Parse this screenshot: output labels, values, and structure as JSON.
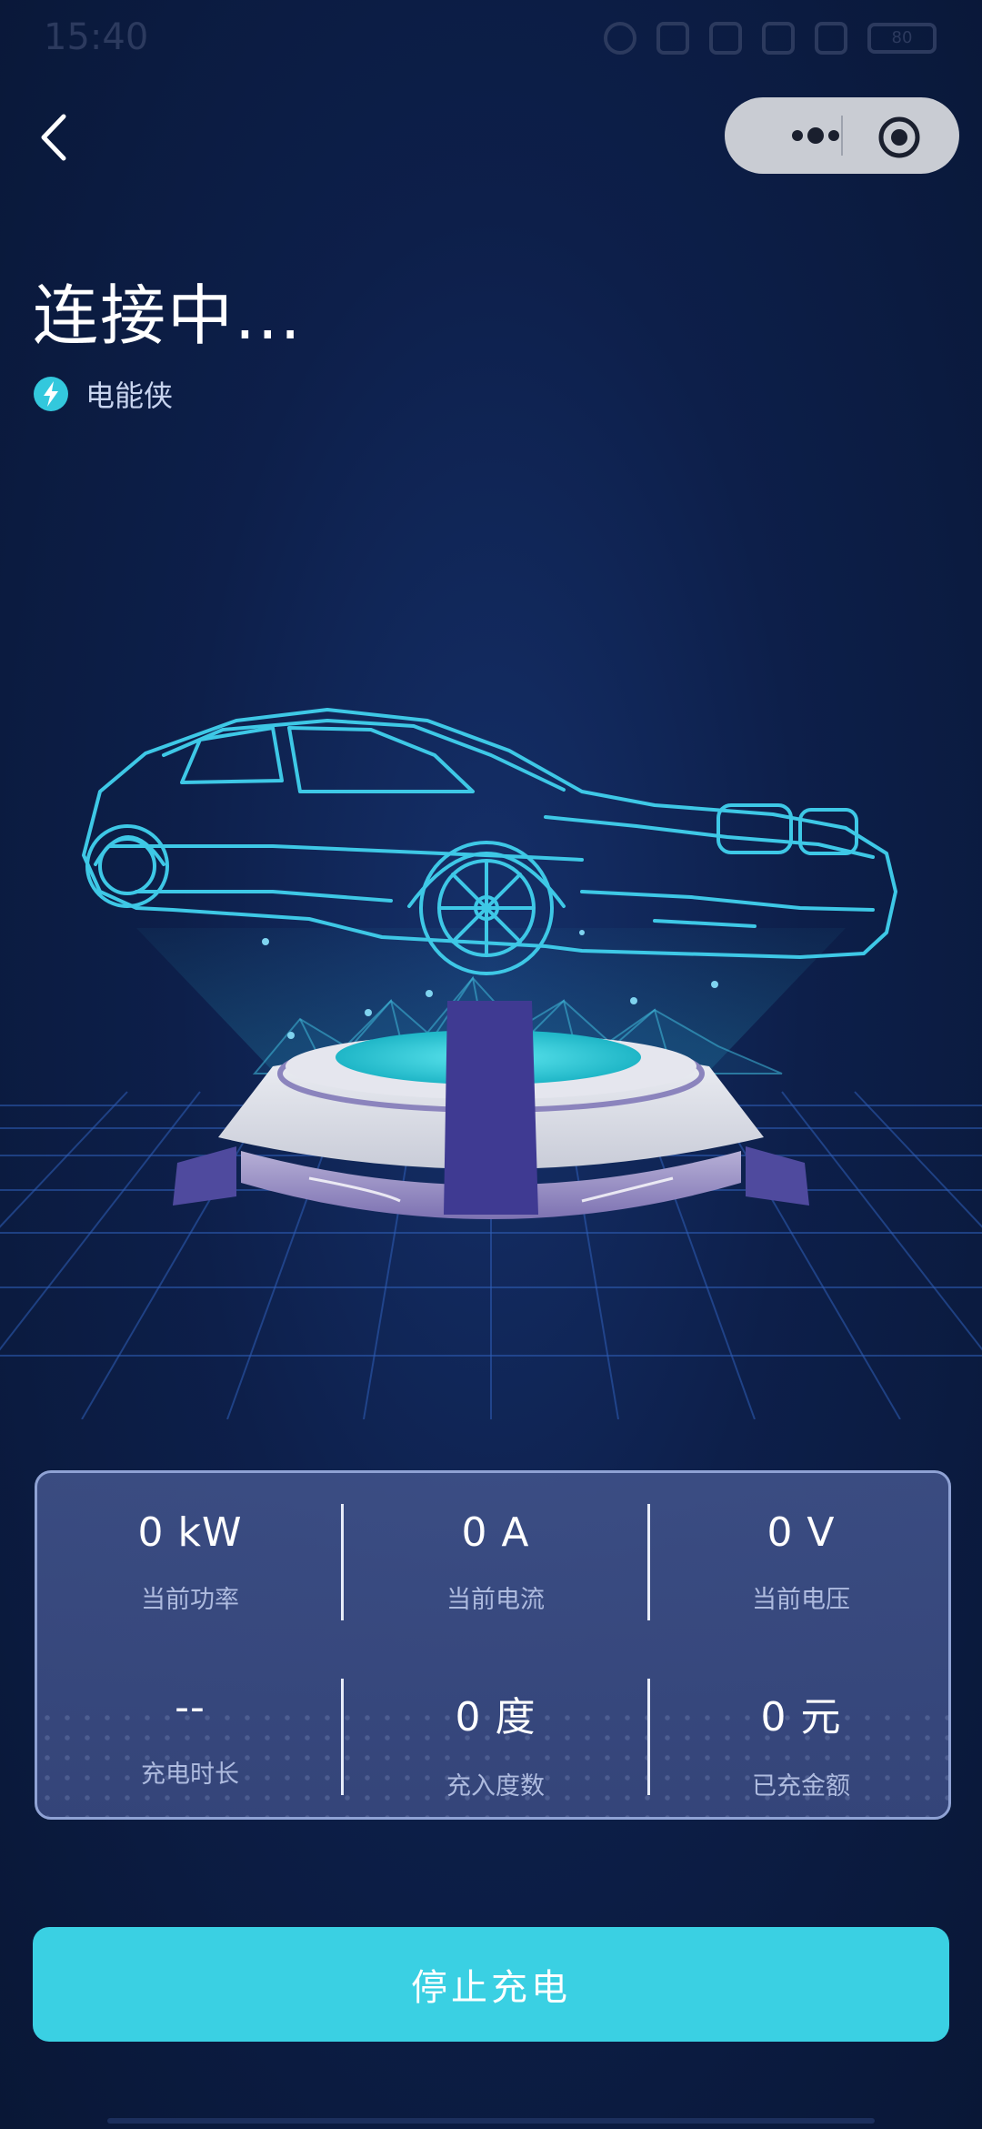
{
  "status_bar": {
    "time": "15:40",
    "battery_level": "80"
  },
  "header": {
    "title": "连接中...",
    "brand": "电能侠"
  },
  "stats": [
    {
      "value": "0 kW",
      "label": "当前功率"
    },
    {
      "value": "0 A",
      "label": "当前电流"
    },
    {
      "value": "0 V",
      "label": "当前电压"
    },
    {
      "value": "--",
      "label": "充电时长"
    },
    {
      "value": "0 度",
      "label": "充入度数"
    },
    {
      "value": "0 元",
      "label": "已充金额"
    }
  ],
  "actions": {
    "stop_label": "停止充电"
  },
  "colors": {
    "background": "#0b1a3e",
    "accent": "#3ad0e3",
    "car_outline": "#3ec8e6",
    "card": "#42548c"
  },
  "icons": {
    "back": "chevron-left-icon",
    "more": "more-dots-icon",
    "close": "target-circle-icon",
    "brand": "lightning-bolt-icon"
  }
}
